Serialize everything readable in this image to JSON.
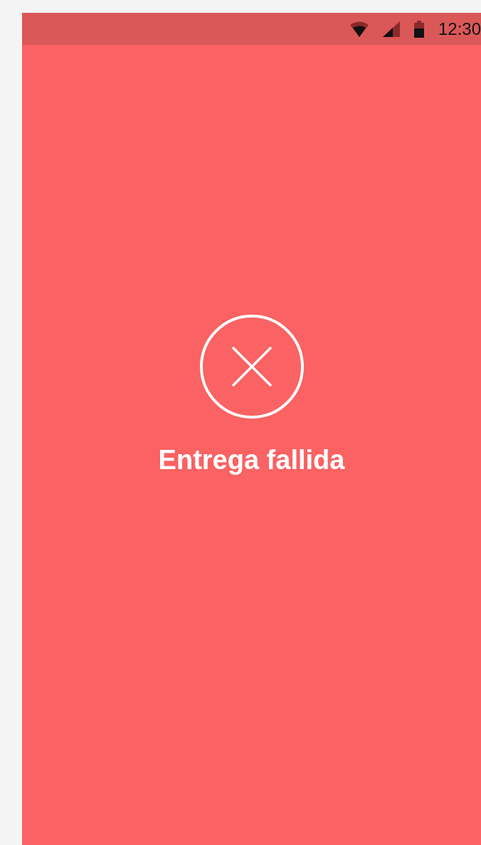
{
  "status_bar": {
    "time": "12:30"
  },
  "result": {
    "kind": "failure",
    "message": "Entrega fallida"
  }
}
